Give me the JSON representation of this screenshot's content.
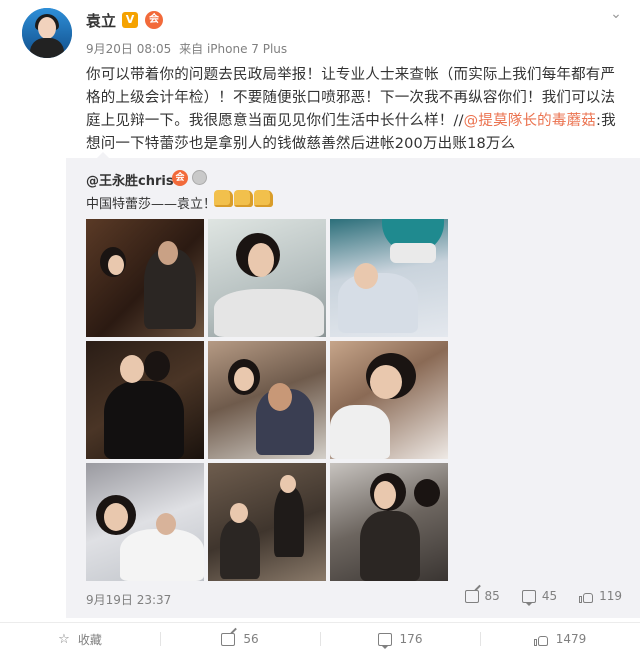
{
  "user": {
    "name": "袁立",
    "verified_icon": "verified-v-icon",
    "member_icon": "vip-member-icon",
    "time": "9月20日 08:05",
    "source": "来自 iPhone 7 Plus"
  },
  "post": {
    "text_main": "你可以带着你的问题去民政局举报！让专业人士来查帐（而实际上我们每年都有严格的上级会计年检）！不要随便张口喷邪恶！下一次我不再纵容你们！我们可以法庭上见辩一下。我很愿意当面见见你们生活中长什么样！//",
    "mention": "@提莫隊长的毒蘑菇",
    "text_tail": ":我想问一下特蕾莎也是拿别人的钱做慈善然后进帐200万出账18万么"
  },
  "repost": {
    "user": "@王永胜chris",
    "text": "中国特蕾莎——袁立！",
    "time": "9月19日 23:37",
    "shares": "85",
    "comments": "45",
    "likes": "119"
  },
  "bottom_bar": {
    "favorite_label": "收藏",
    "share_count": "56",
    "comment_count": "176",
    "like_count": "1479"
  },
  "colors": {
    "mention": "#eb7350",
    "repost_bg": "#f2f2f5",
    "muted": "#808080"
  }
}
